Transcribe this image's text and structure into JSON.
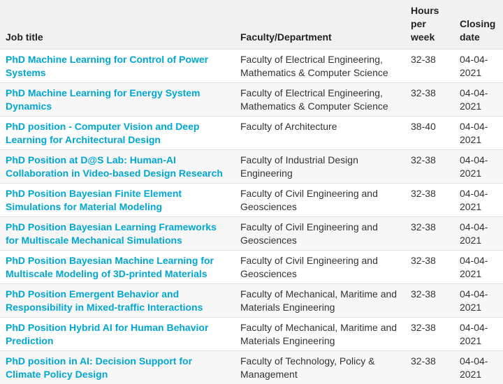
{
  "table": {
    "headers": {
      "title": "Job title",
      "faculty": "Faculty/Department",
      "hours": "Hours per week",
      "closing": "Closing date"
    },
    "rows": [
      {
        "title": "PhD Machine Learning for Control of Power Systems",
        "faculty": "Faculty of Electrical Engineering, Mathematics & Computer Science",
        "hours": "32-38",
        "closing": "04-04-2021"
      },
      {
        "title": "PhD Machine Learning for Energy System Dynamics",
        "faculty": "Faculty of Electrical Engineering, Mathematics & Computer Science",
        "hours": "32-38",
        "closing": "04-04-2021"
      },
      {
        "title": "PhD position - Computer Vision and Deep Learning for Architectural Design",
        "faculty": "Faculty of Architecture",
        "hours": "38-40",
        "closing": "04-04-2021"
      },
      {
        "title": "PhD Position at D@S Lab: Human-AI Collaboration in Video-based Design Research",
        "faculty": "Faculty of Industrial Design Engineering",
        "hours": "32-38",
        "closing": "04-04-2021"
      },
      {
        "title": "PhD Position Bayesian Finite Element Simulations for Material Modeling",
        "faculty": "Faculty of Civil Engineering and Geosciences",
        "hours": "32-38",
        "closing": "04-04-2021"
      },
      {
        "title": "PhD Position Bayesian Learning Frameworks for Multiscale Mechanical Simulations",
        "faculty": "Faculty of Civil Engineering and Geosciences",
        "hours": "32-38",
        "closing": "04-04-2021"
      },
      {
        "title": "PhD Position Bayesian Machine Learning for Multiscale Modeling of 3D-printed Materials",
        "faculty": "Faculty of Civil Engineering and Geosciences",
        "hours": "32-38",
        "closing": "04-04-2021"
      },
      {
        "title": "PhD Position Emergent Behavior and Responsibility in Mixed-traffic Interactions",
        "faculty": "Faculty of Mechanical, Maritime and Materials Engineering",
        "hours": "32-38",
        "closing": "04-04-2021"
      },
      {
        "title": "PhD Position Hybrid AI for Human Behavior Prediction",
        "faculty": "Faculty of Mechanical, Maritime and Materials Engineering",
        "hours": "32-38",
        "closing": "04-04-2021"
      },
      {
        "title": "PhD position in AI: Decision Support for Climate Policy Design",
        "faculty": "Faculty of Technology, Policy & Management",
        "hours": "32-38",
        "closing": "04-04-2021"
      }
    ]
  },
  "colors": {
    "link": "#00a6d6",
    "header_bg": "#f1f1f1",
    "stripe_bg": "#f7f7f7"
  }
}
